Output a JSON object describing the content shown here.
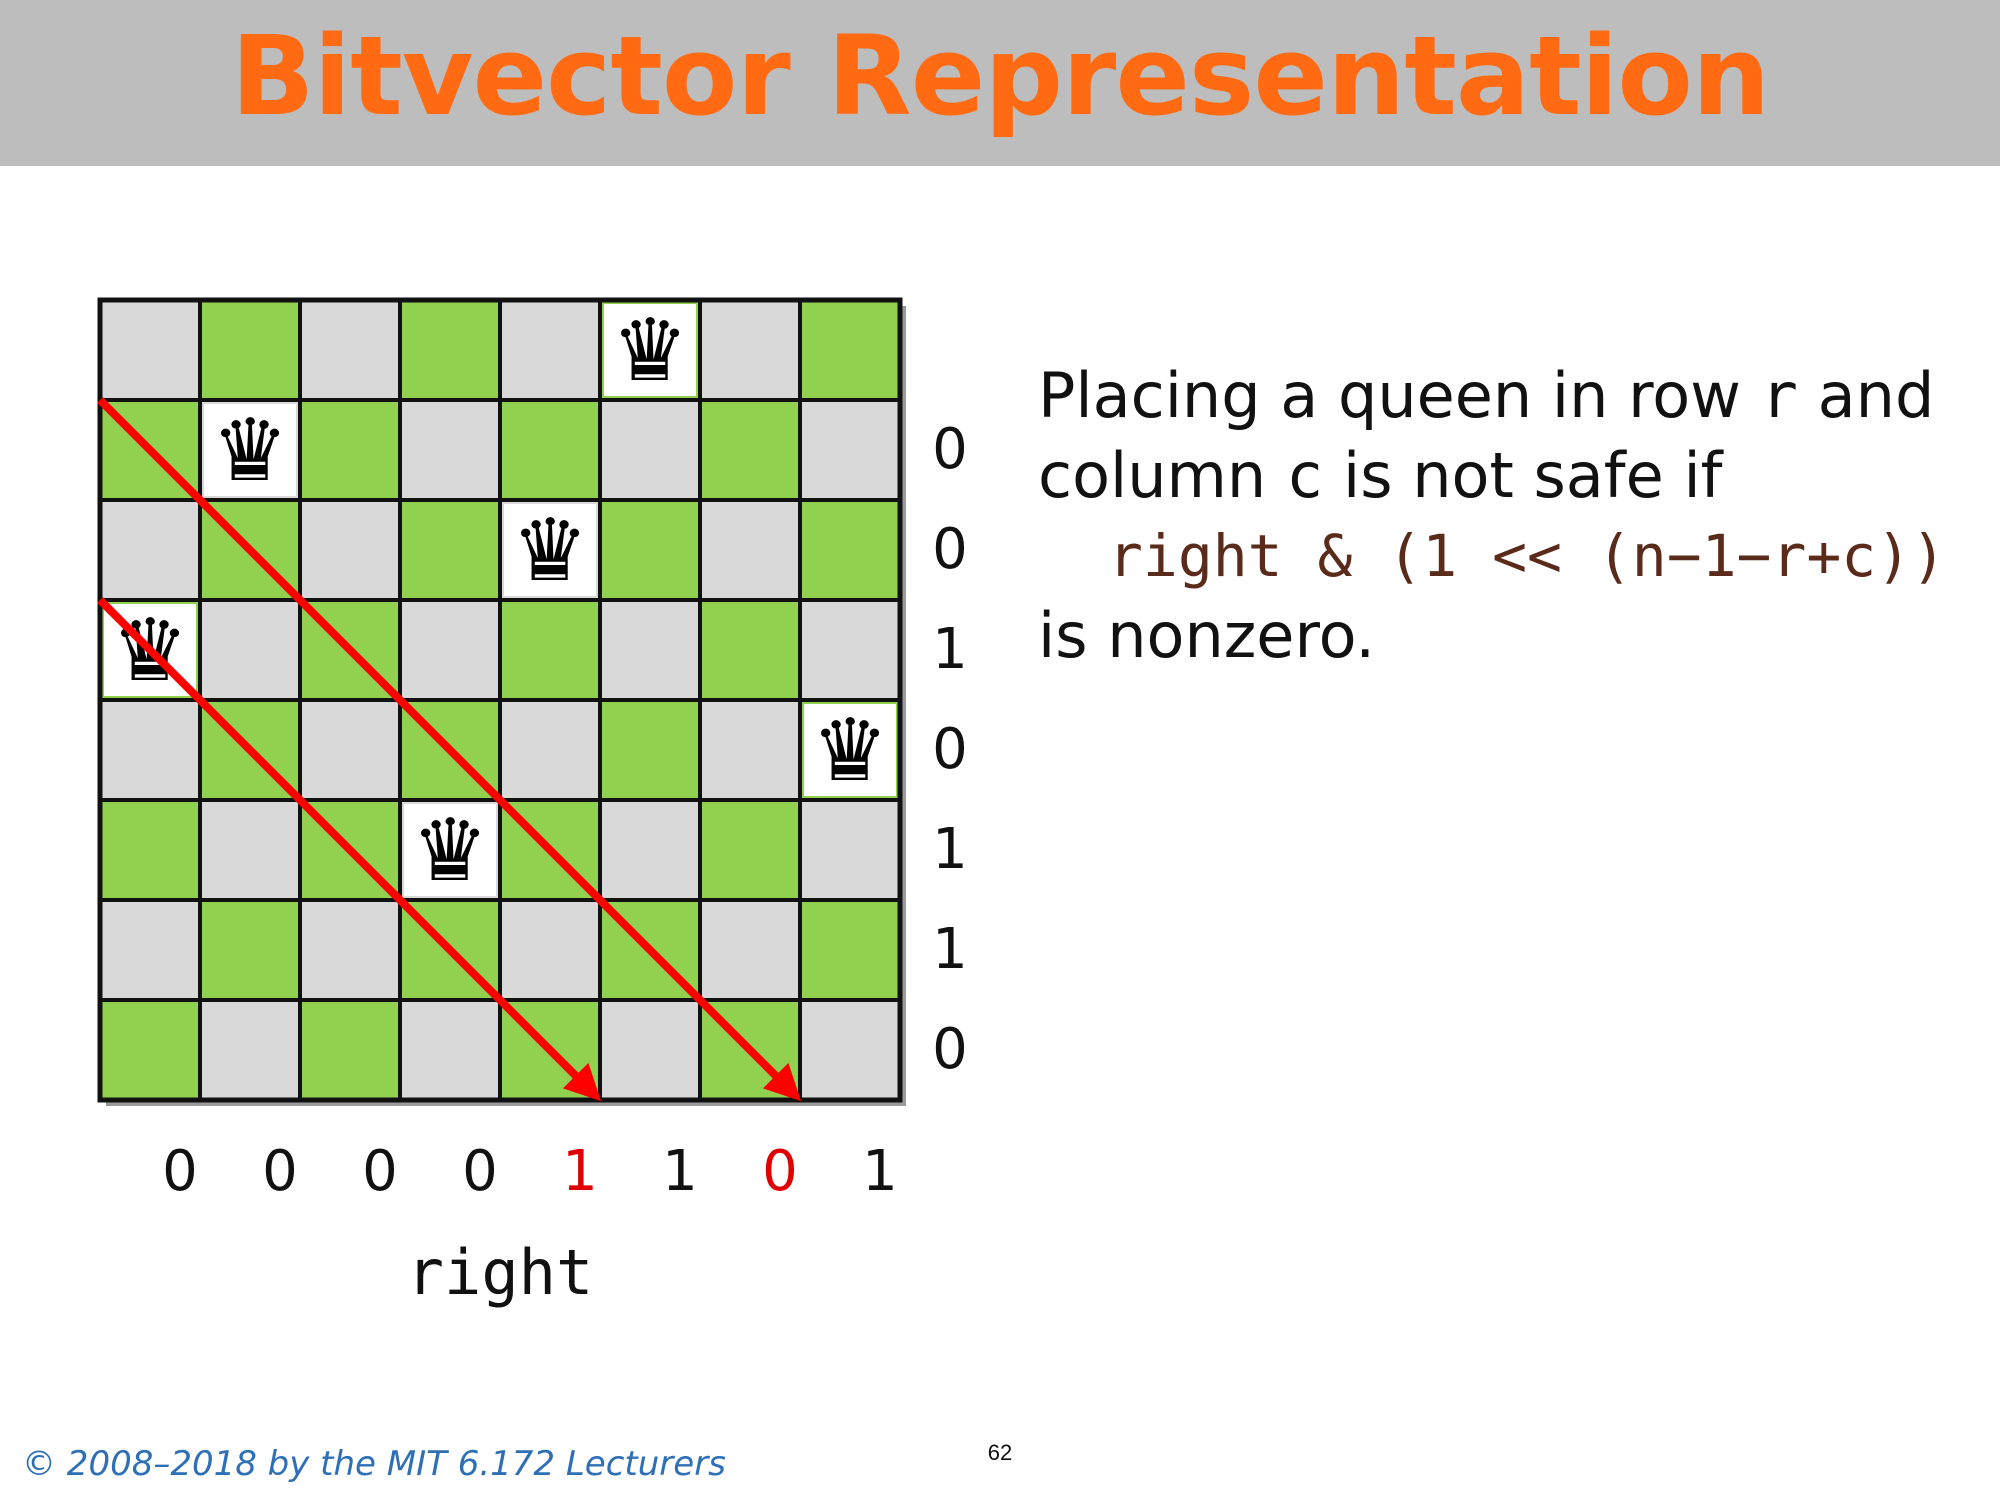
{
  "slide": {
    "title": "Bitvector Representation",
    "page_number": "62",
    "footer": "© 2008–2018 by the MIT 6.172 Lecturers"
  },
  "board": {
    "size": 8,
    "light_color": "#d9d9d9",
    "dark_color": "#92d050",
    "queens": [
      {
        "row": 0,
        "col": 5
      },
      {
        "row": 1,
        "col": 1
      },
      {
        "row": 2,
        "col": 4
      },
      {
        "row": 3,
        "col": 0
      },
      {
        "row": 4,
        "col": 7
      },
      {
        "row": 5,
        "col": 3
      }
    ],
    "arrows": [
      {
        "from": {
          "row": 1,
          "col": 0
        },
        "to": {
          "row": 7,
          "col": 6
        }
      },
      {
        "from": {
          "row": 3,
          "col": 0
        },
        "to": {
          "row": 7,
          "col": 4
        }
      }
    ],
    "arrow_color": "#ff0000",
    "queen_icon": "black-queen-icon"
  },
  "side_bits": [
    "0",
    "0",
    "1",
    "0",
    "1",
    "1",
    "0"
  ],
  "bottom_bits": [
    {
      "value": "0",
      "highlight": false
    },
    {
      "value": "0",
      "highlight": false
    },
    {
      "value": "0",
      "highlight": false
    },
    {
      "value": "0",
      "highlight": false
    },
    {
      "value": "1",
      "highlight": true
    },
    {
      "value": "1",
      "highlight": false
    },
    {
      "value": "0",
      "highlight": true
    },
    {
      "value": "1",
      "highlight": false
    }
  ],
  "highlight_color": "#e00000",
  "bitvector_label": "right",
  "description": {
    "line1_pre": "Placing a queen in row ",
    "line1_var": "r",
    "line1_post": " and",
    "line2_pre": "column ",
    "line2_var": "c",
    "line2_post": " is not safe if",
    "code": "right & (1 << (n−1−r+c))",
    "line4": "is nonzero."
  }
}
